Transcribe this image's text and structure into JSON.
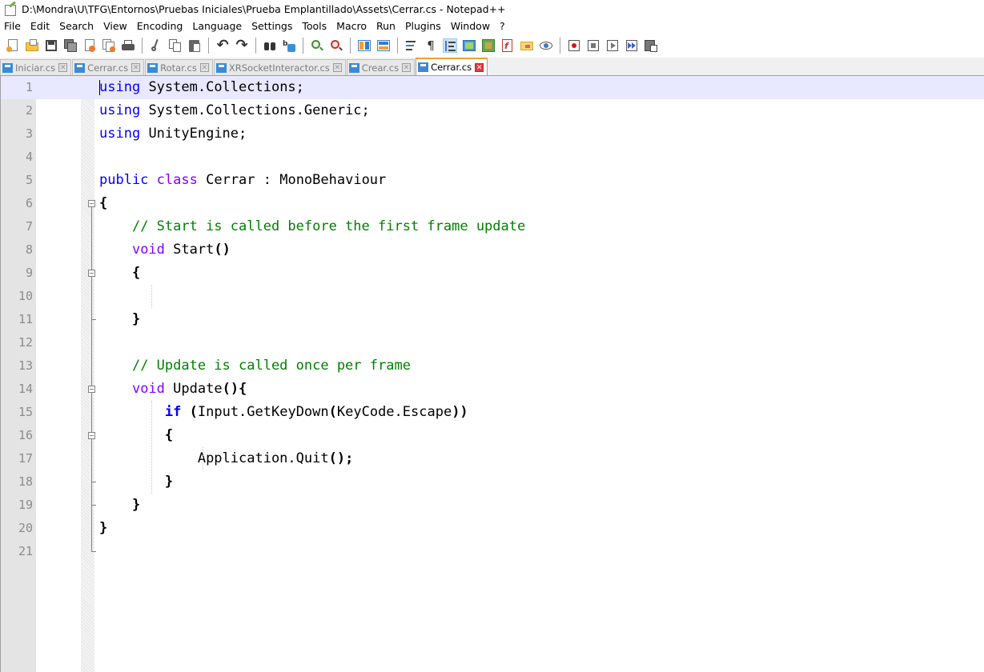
{
  "window": {
    "title": "D:\\Mondra\\U\\TFG\\Entornos\\Pruebas Iniciales\\Prueba Emplantillado\\Assets\\Cerrar.cs - Notepad++"
  },
  "menu": [
    "File",
    "Edit",
    "Search",
    "View",
    "Encoding",
    "Language",
    "Settings",
    "Tools",
    "Macro",
    "Run",
    "Plugins",
    "Window",
    "?"
  ],
  "tabs": [
    {
      "label": "Iniciar.cs",
      "active": false
    },
    {
      "label": "Cerrar.cs",
      "active": false
    },
    {
      "label": "Rotar.cs",
      "active": false
    },
    {
      "label": "XRSocketInteractor.cs",
      "active": false
    },
    {
      "label": "Crear.cs",
      "active": false
    },
    {
      "label": "Cerrar.cs",
      "active": true
    }
  ],
  "tab_close_glyph": "✕",
  "editor": {
    "current_line": 1,
    "line_numbers": [
      "1",
      "2",
      "3",
      "4",
      "5",
      "6",
      "7",
      "8",
      "9",
      "10",
      "11",
      "12",
      "13",
      "14",
      "15",
      "16",
      "17",
      "18",
      "19",
      "20",
      "21"
    ],
    "tokens": {
      "using": "using",
      "ns_collections": "System.Collections;",
      "ns_generic": "System.Collections.Generic;",
      "ns_unity": "UnityEngine;",
      "public": "public",
      "class": "class",
      "class_decl": "Cerrar : MonoBehaviour",
      "open_brace": "{",
      "close_brace": "}",
      "comment_start": "// Start is called before the first frame update",
      "void": "void",
      "start_sig": "Start",
      "parens": "()",
      "comment_update": "// Update is called once per frame",
      "update_sig": "Update",
      "parens_brace": "(){",
      "if": "if",
      "if_open": "(",
      "if_cond_a": "Input.GetKeyDown",
      "if_cond_b": "KeyCode.Escape",
      "if_close": "))",
      "quit_call": "Application.Quit",
      "quit_end": "();"
    }
  },
  "colors": {
    "keyword": "#0000ff",
    "type_keyword": "#8000ff",
    "comment": "#008000",
    "current_line": "#e8e8ff",
    "active_tab_accent": "#f0a030"
  },
  "toolbar_icons": [
    "new-file-icon",
    "open-file-icon",
    "save-icon",
    "save-all-icon",
    "close-icon",
    "close-all-icon",
    "print-icon",
    "cut-icon",
    "copy-icon",
    "paste-icon",
    "undo-icon",
    "redo-icon",
    "find-icon",
    "replace-icon",
    "zoom-in-icon",
    "zoom-out-icon",
    "sync-vertical-icon",
    "sync-horizontal-icon",
    "word-wrap-icon",
    "show-all-chars-icon",
    "indent-guide-icon",
    "udl-icon",
    "doc-map-icon",
    "function-list-icon",
    "folder-workspace-icon",
    "monitoring-icon",
    "record-macro-icon",
    "stop-record-icon",
    "play-macro-icon",
    "run-macro-multiple-icon",
    "save-macro-icon"
  ]
}
